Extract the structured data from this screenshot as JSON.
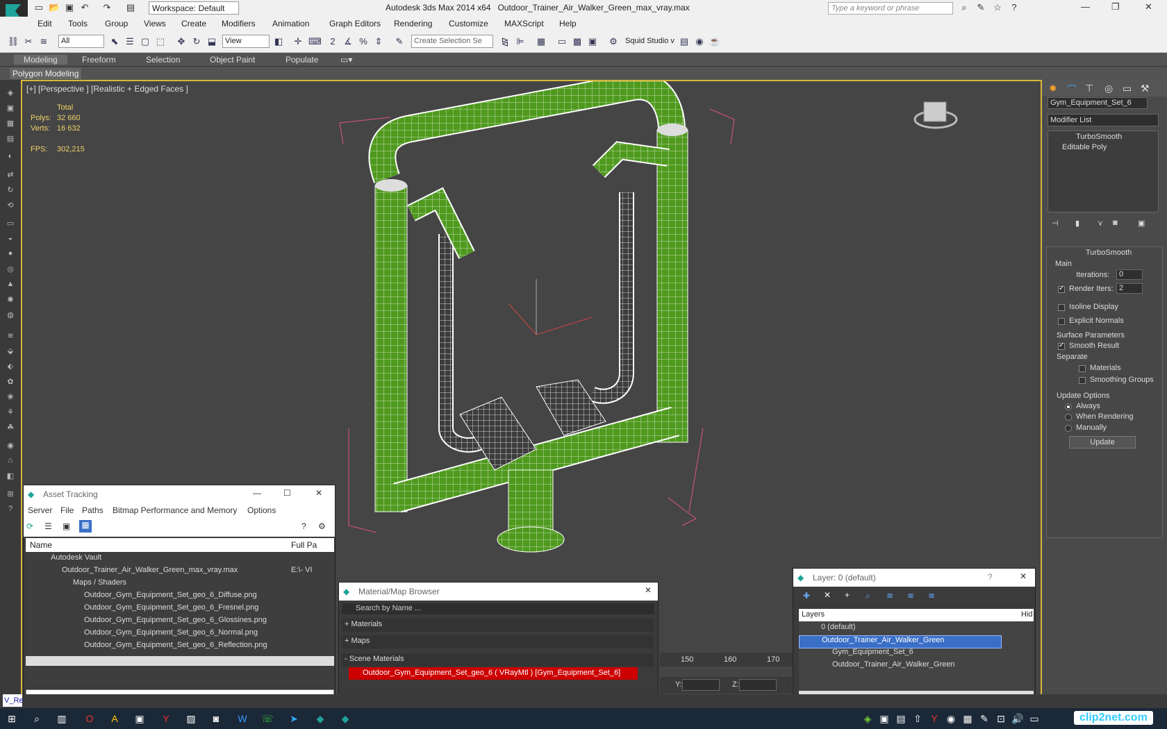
{
  "app": {
    "title": "Autodesk 3ds Max  2014 x64",
    "file": "Outdoor_Trainer_Air_Walker_Green_max_vray.max",
    "workspace": "Workspace: Default",
    "search_placeholder": "Type a keyword or phrase"
  },
  "menu": [
    "Edit",
    "Tools",
    "Group",
    "Views",
    "Create",
    "Modifiers",
    "Animation",
    "Graph Editors",
    "Rendering",
    "Customize",
    "MAXScript",
    "Help"
  ],
  "toolbar": {
    "filter": "All",
    "view": "View",
    "selection_set": "Create Selection Se",
    "squid": "Squid Studio v"
  },
  "ribbon": {
    "tabs": [
      "Modeling",
      "Freeform",
      "Selection",
      "Object Paint",
      "Populate"
    ],
    "active": "Modeling",
    "sub": "Polygon Modeling"
  },
  "viewport": {
    "label": "[+] [Perspective ] [Realistic + Edged Faces ]",
    "stats_header": "Total",
    "polys_label": "Polys:",
    "polys": "32 660",
    "verts_label": "Verts:",
    "verts": "16 632",
    "fps_label": "FPS:",
    "fps": "302,215"
  },
  "right_panel": {
    "object_name": "Gym_Equipment_Set_6",
    "modifier_list": "Modifier List",
    "stack": [
      "TurboSmooth",
      "Editable Poly"
    ],
    "rollout": "TurboSmooth",
    "main": "Main",
    "iterations_label": "Iterations:",
    "iterations": "0",
    "render_iters_label": "Render Iters:",
    "render_iters": "2",
    "isoline": "Isoline Display",
    "explicit": "Explicit Normals",
    "surface": "Surface Parameters",
    "smooth": "Smooth Result",
    "separate": "Separate",
    "materials": "Materials",
    "smoothing": "Smoothing Groups",
    "update_options": "Update Options",
    "always": "Always",
    "when_rendering": "When Rendering",
    "manually": "Manually",
    "update_btn": "Update"
  },
  "asset_tracking": {
    "title": "Asset Tracking",
    "menu": [
      "Server",
      "File",
      "Paths",
      "Bitmap Performance and Memory",
      "Options"
    ],
    "col_name": "Name",
    "col_path": "Full Pa",
    "rows": [
      {
        "name": "Autodesk Vault",
        "path": ""
      },
      {
        "name": "Outdoor_Trainer_Air_Walker_Green_max_vray.max",
        "path": "E:\\- VI"
      },
      {
        "name": "Maps / Shaders",
        "path": ""
      },
      {
        "name": "Outdoor_Gym_Equipment_Set_geo_6_Diffuse.png",
        "path": ""
      },
      {
        "name": "Outdoor_Gym_Equipment_Set_geo_6_Fresnel.png",
        "path": ""
      },
      {
        "name": "Outdoor_Gym_Equipment_Set_geo_6_Glossines.png",
        "path": ""
      },
      {
        "name": "Outdoor_Gym_Equipment_Set_geo_6_Normal.png",
        "path": ""
      },
      {
        "name": "Outdoor_Gym_Equipment_Set_geo_6_Reflection.png",
        "path": ""
      }
    ]
  },
  "material_browser": {
    "title": "Material/Map Browser",
    "search": "Search by Name ...",
    "materials": "+ Materials",
    "maps": "+ Maps",
    "scene": "- Scene Materials",
    "item": "Outdoor_Gym_Equipment_Set_geo_6  ( VRayMtl )  [Gym_Equipment_Set_6]"
  },
  "layer": {
    "title": "Layer: 0 (default)",
    "col_layers": "Layers",
    "col_hide": "Hid",
    "rows": [
      "0 (default)",
      "Outdoor_Trainer_Air_Walker_Green",
      "Gym_Equipment_Set_6",
      "Outdoor_Trainer_Air_Walker_Green"
    ]
  },
  "timeline": {
    "ticks": [
      "150",
      "160",
      "170"
    ],
    "y": "Y:",
    "z": "Z:"
  },
  "status_left": "V_Re",
  "watermark": "clip2net.com",
  "colors": {
    "accent": "#d9b63a",
    "selection": "#3a6fc7",
    "mesh": "#4f9a1e",
    "bbox": "#e0567a"
  }
}
